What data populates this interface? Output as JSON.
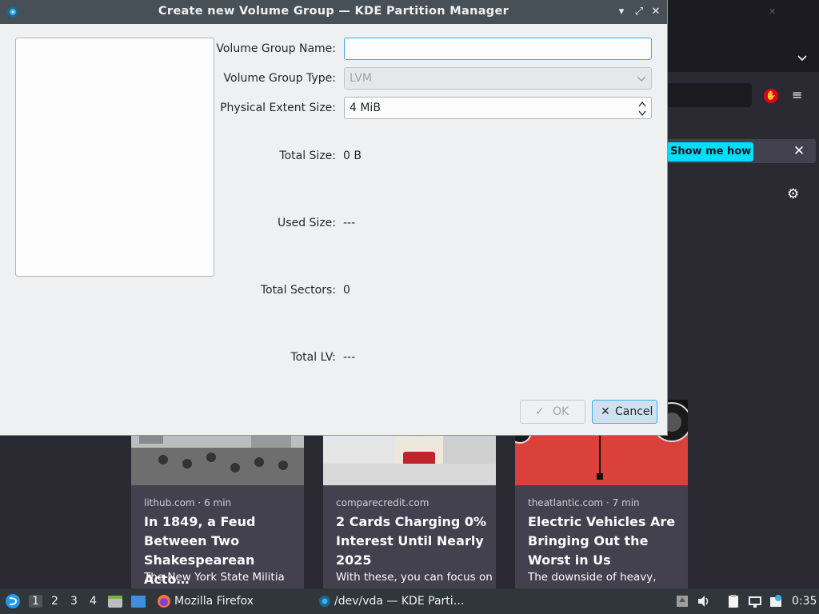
{
  "dialog": {
    "title": "Create new Volume Group — KDE Partition Manager",
    "fields": {
      "vg_name_label": "Volume Group Name:",
      "vg_name_value": "",
      "vg_type_label": "Volume Group Type:",
      "vg_type_value": "LVM",
      "pe_size_label": "Physical Extent Size:",
      "pe_size_value": "4 MiB"
    },
    "info": {
      "total_size_label": "Total Size:",
      "total_size_value": "0 B",
      "used_size_label": "Used Size:",
      "used_size_value": "---",
      "total_sectors_label": "Total Sectors:",
      "total_sectors_value": "0",
      "total_lv_label": "Total LV:",
      "total_lv_value": "---"
    },
    "buttons": {
      "ok": "OK",
      "cancel": "Cancel"
    }
  },
  "firefox": {
    "notification_button": "Show me how",
    "cards": [
      {
        "source": "lithub.com · 6 min",
        "title": "In 1849, a Feud Between Two Shakespearean Acto…",
        "excerpt": "The New York State Militia"
      },
      {
        "source": "comparecredit.com",
        "title": "2 Cards Charging 0% Interest Until Nearly 2025",
        "excerpt": "With these, you can focus on"
      },
      {
        "source": "theatlantic.com · 7 min",
        "title": "Electric Vehicles Are Bringing Out the Worst in Us",
        "excerpt": "The downside of heavy,"
      }
    ]
  },
  "taskbar": {
    "workspaces": [
      "1",
      "2",
      "3",
      "4"
    ],
    "tasks": [
      "Mozilla Firefox",
      "/dev/vda — KDE Parti…"
    ],
    "clock": "0:35"
  },
  "colors": {
    "accent": "#3daee9",
    "titlebar": "#475057",
    "window_bg": "#eff0f1",
    "taskbar": "#31363b",
    "firefox_bg": "#2b2a33",
    "firefox_cta": "#00ddff"
  }
}
